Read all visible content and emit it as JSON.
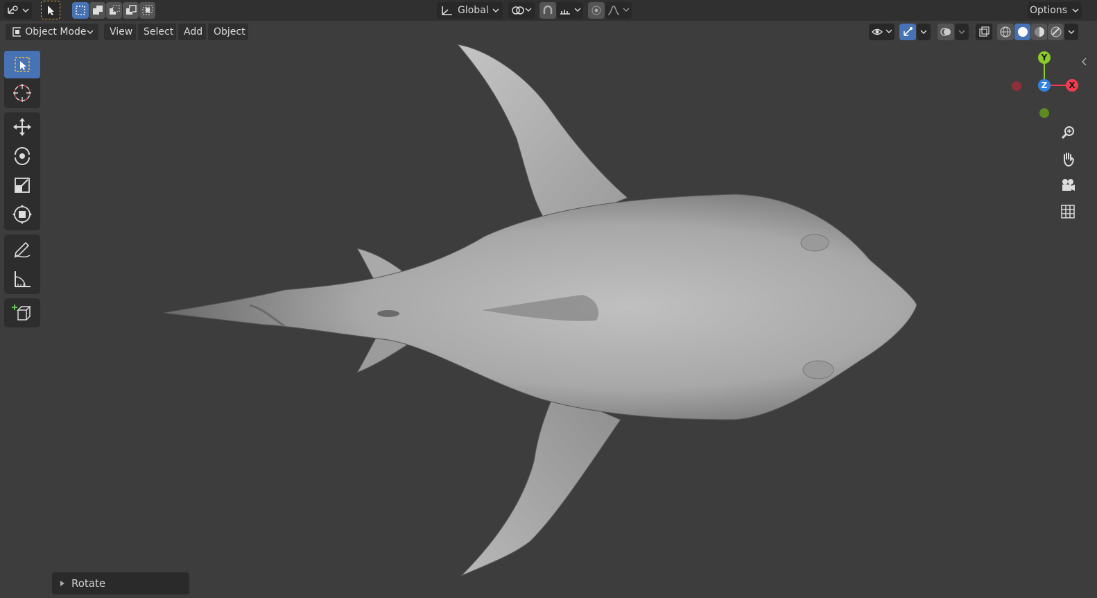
{
  "topbar": {
    "orientation": {
      "label": "Global"
    },
    "options_label": "Options"
  },
  "header": {
    "mode": {
      "label": "Object Mode"
    },
    "menus": [
      {
        "label": "View"
      },
      {
        "label": "Select"
      },
      {
        "label": "Add"
      },
      {
        "label": "Object"
      }
    ]
  },
  "gizmo": {
    "y_label": "Y",
    "z_label": "Z",
    "x_label": "X",
    "colors": {
      "x": "#f53a50",
      "y": "#8bcc28",
      "z": "#2f84e3"
    }
  },
  "operator_panel": {
    "label": "Rotate"
  },
  "theme": {
    "accent": "#4772b3",
    "viewport_bg": "#3d3d3d"
  }
}
